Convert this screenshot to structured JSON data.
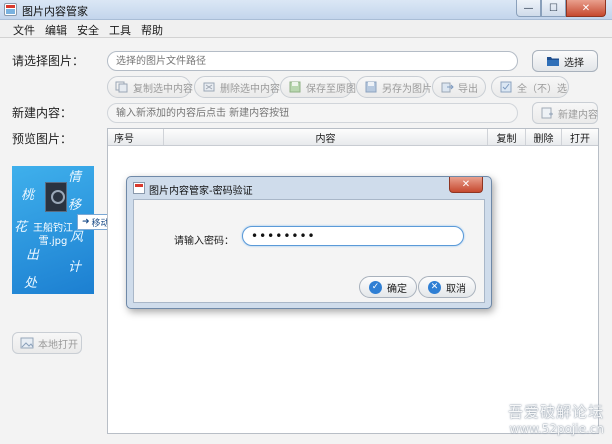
{
  "window": {
    "title": "图片内容管家",
    "minimize": "—",
    "maximize": "☐",
    "close": "✕"
  },
  "menu": [
    "文件",
    "编辑",
    "安全",
    "工具",
    "帮助"
  ],
  "select_image": {
    "label": "请选择图片：",
    "placeholder": "选择的图片文件路径",
    "button": "选择"
  },
  "toolbar": {
    "copy": "复制选中内容",
    "delete": "删除选中内容",
    "save_original": "保存至原图",
    "save_as": "另存为图片",
    "export": "导出",
    "select_all": "全（不）选"
  },
  "new_content": {
    "label": "新建内容：",
    "placeholder": "输入新添加的内容后点击 新建内容按钮",
    "button": "新建内容"
  },
  "preview": {
    "label": "预览图片：",
    "filename": "王船钓江雪.jpg",
    "move": "移动",
    "open_local": "本地打开",
    "calligraphy": [
      "情",
      "桃",
      "移",
      "花",
      "风",
      "出",
      "计",
      "处"
    ]
  },
  "table": {
    "columns": [
      "序号",
      "内容",
      "复制",
      "删除",
      "打开"
    ]
  },
  "dialog": {
    "title": "图片内容管家-密码验证",
    "close": "✕",
    "password_label": "请输入密码：",
    "password_value": "••••••••",
    "ok": "确定",
    "cancel": "取消"
  },
  "watermark": {
    "line1": "吾爱破解论坛",
    "line2": "www.52pojie.cn"
  },
  "colors": {
    "accent": "#3a8ad6",
    "ok": "#2f7fd4",
    "cancel": "#2f7fd4",
    "close": "#c6492f"
  }
}
